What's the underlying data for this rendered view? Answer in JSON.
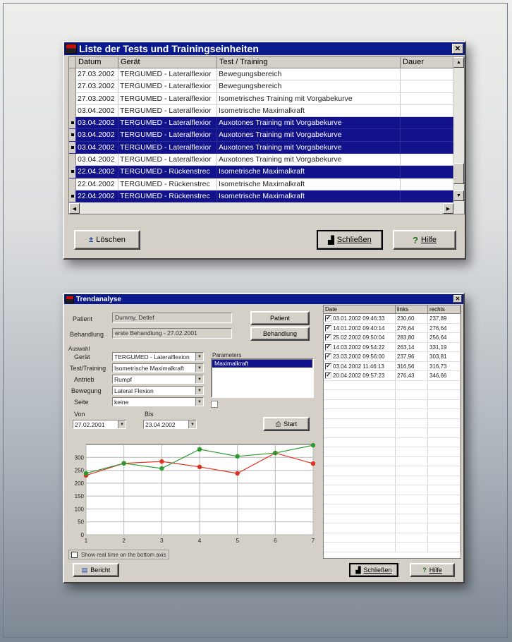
{
  "list_window": {
    "title": "Liste der Tests und Trainingseinheiten",
    "close_label": "✕",
    "columns": [
      "Datum",
      "Gerät",
      "Test / Training",
      "Dauer"
    ],
    "rows": [
      {
        "date": "27.03.2002",
        "device": "TERGUMED - Lateralflexior",
        "test": "Bewegungsbereich",
        "duration": "",
        "selected": false
      },
      {
        "date": "27.03.2002",
        "device": "TERGUMED - Lateralflexior",
        "test": "Bewegungsbereich",
        "duration": "",
        "selected": false
      },
      {
        "date": "27.03.2002",
        "device": "TERGUMED - Lateralflexior",
        "test": "Isometrisches Training mit Vorgabekurve",
        "duration": "",
        "selected": false
      },
      {
        "date": "03.04.2002",
        "device": "TERGUMED - Lateralflexior",
        "test": "Isometrische Maximalkraft",
        "duration": "",
        "selected": false
      },
      {
        "date": "03.04.2002",
        "device": "TERGUMED - Lateralflexior",
        "test": "Auxotones Training mit Vorgabekurve",
        "duration": "",
        "selected": true
      },
      {
        "date": "03.04.2002",
        "device": "TERGUMED - Lateralflexior",
        "test": "Auxotones Training mit Vorgabekurve",
        "duration": "",
        "selected": true
      },
      {
        "date": "03.04.2002",
        "device": "TERGUMED - Lateralflexior",
        "test": "Auxotones Training mit Vorgabekurve",
        "duration": "",
        "selected": true
      },
      {
        "date": "03.04.2002",
        "device": "TERGUMED - Lateralflexior",
        "test": "Auxotones Training mit Vorgabekurve",
        "duration": "",
        "selected": false
      },
      {
        "date": "22.04.2002",
        "device": "TERGUMED - Rückenstrec",
        "test": "Isometrische Maximalkraft",
        "duration": "",
        "selected": true
      },
      {
        "date": "22.04.2002",
        "device": "TERGUMED - Rückenstrec",
        "test": "Isometrische Maximalkraft",
        "duration": "",
        "selected": false
      },
      {
        "date": "22.04.2002",
        "device": "TERGUMED - Rückenstrec",
        "test": "Isometrische Maximalkraft",
        "duration": "",
        "selected": true
      }
    ],
    "buttons": {
      "delete": "Löschen",
      "close": "Schließen",
      "help": "Hilfe"
    },
    "colors": {
      "title_bg": "#0a1a8c",
      "selection": "#12128a"
    }
  },
  "trend_window": {
    "title": "Trendanalyse",
    "close_label": "✕",
    "patient_label": "Patient",
    "patient_value": "Dummy, Detlef",
    "patient_button": "Patient",
    "treatment_label": "Behandlung",
    "treatment_value": "erste Behandlung - 27.02.2001",
    "treatment_button": "Behandlung",
    "selection_label": "Auswahl",
    "device_label": "Gerät",
    "device_value": "TERGUMED - Lateralflexion",
    "test_label": "Test/Training",
    "test_value": "Isometrische Maximalkraft",
    "drive_label": "Antrieb",
    "drive_value": "Rumpf",
    "movement_label": "Bewegung",
    "movement_value": "Lateral Flexion",
    "side_label": "Seite",
    "side_value": "keine",
    "params_label": "Parameters",
    "params_items": [
      "Maximalkraft"
    ],
    "from_label": "Von",
    "from_value": "27.02.2001",
    "to_label": "Bis",
    "to_value": "23.04.2002",
    "start_button": "Start",
    "real_time_checkbox": "Show real time on the bottom axis",
    "report_button": "Bericht",
    "close_button": "Schließen",
    "help_button": "Hilfe",
    "results": {
      "columns": [
        "Date",
        "links",
        "rechts"
      ],
      "rows": [
        {
          "date": "03.01.2002 09:46:33",
          "left": "230,60",
          "right": "237,89",
          "checked": true
        },
        {
          "date": "14.01.2002 09:40:14",
          "left": "276,64",
          "right": "276,64",
          "checked": true
        },
        {
          "date": "25.02.2002 09:50:04",
          "left": "283,80",
          "right": "256,64",
          "checked": true
        },
        {
          "date": "14.03.2002 09:54:22",
          "left": "263,14",
          "right": "331,19",
          "checked": true
        },
        {
          "date": "23.03.2002 09:56:00",
          "left": "237,96",
          "right": "303,81",
          "checked": true
        },
        {
          "date": "03.04.2002 11:46:13",
          "left": "316,56",
          "right": "316,73",
          "checked": true
        },
        {
          "date": "20.04.2002 09:57:23",
          "left": "276,43",
          "right": "346,66",
          "checked": true
        }
      ]
    }
  },
  "chart_data": {
    "type": "line",
    "x": [
      1,
      2,
      3,
      4,
      5,
      6,
      7
    ],
    "series": [
      {
        "color": "#e03020",
        "values": [
          230,
          277,
          284,
          263,
          238,
          317,
          276
        ]
      },
      {
        "color": "#2e9a2e",
        "values": [
          238,
          277,
          257,
          331,
          304,
          317,
          347
        ]
      }
    ],
    "xlim": [
      1,
      7
    ],
    "ylim": [
      0,
      350
    ],
    "yticks": [
      0,
      50,
      100,
      150,
      200,
      250,
      300
    ],
    "xticks": [
      1,
      2,
      3,
      4,
      5,
      6,
      7
    ],
    "grid": true
  }
}
